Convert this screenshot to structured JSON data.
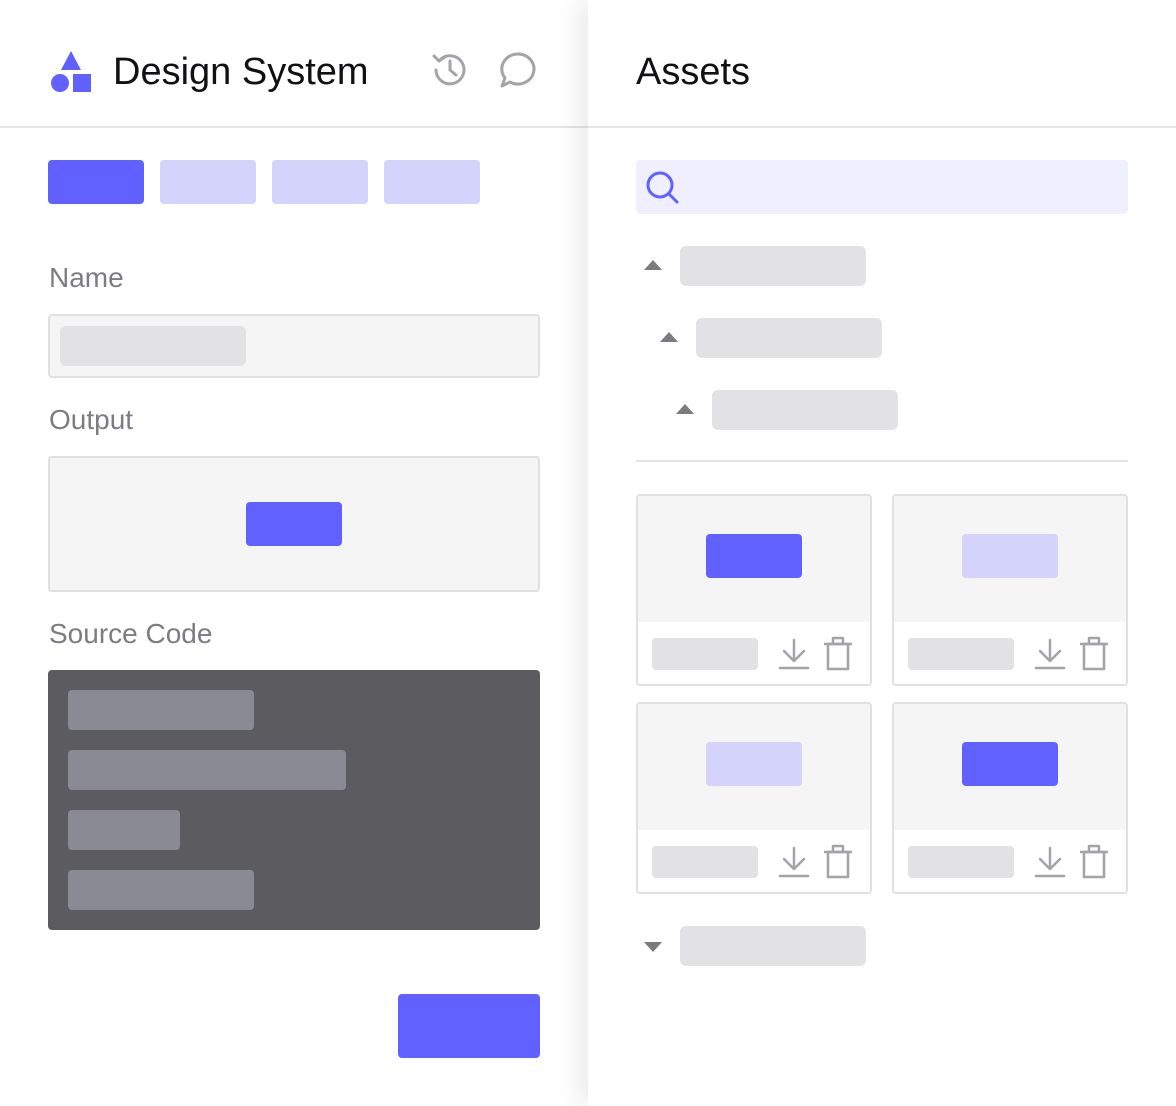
{
  "app": {
    "title": "Design System",
    "logo_icon": "shapes-logo-icon",
    "header_icons": [
      "history-icon",
      "comment-icon"
    ]
  },
  "tabs": [
    {
      "state": "active"
    },
    {
      "state": "inactive"
    },
    {
      "state": "inactive"
    },
    {
      "state": "inactive"
    }
  ],
  "form": {
    "name_label": "Name",
    "output_label": "Output",
    "source_label": "Source Code"
  },
  "assets": {
    "title": "Assets",
    "search_icon": "search-icon",
    "tree": [
      {
        "level": 0,
        "state": "expanded"
      },
      {
        "level": 1,
        "state": "expanded"
      },
      {
        "level": 2,
        "state": "expanded"
      }
    ],
    "cards": [
      {
        "swatch_color": "#6161ff",
        "actions": [
          "download-icon",
          "trash-icon"
        ]
      },
      {
        "swatch_color": "#d4d3fb",
        "actions": [
          "download-icon",
          "trash-icon"
        ]
      },
      {
        "swatch_color": "#d4d3fb",
        "actions": [
          "download-icon",
          "trash-icon"
        ]
      },
      {
        "swatch_color": "#6161ff",
        "actions": [
          "download-icon",
          "trash-icon"
        ]
      }
    ],
    "collapsed_group": {
      "state": "collapsed"
    }
  },
  "colors": {
    "accent": "#6161ff",
    "accent_light": "#d4d3fb",
    "code_bg": "#5c5b60",
    "placeholder": "#e2e2e4"
  }
}
